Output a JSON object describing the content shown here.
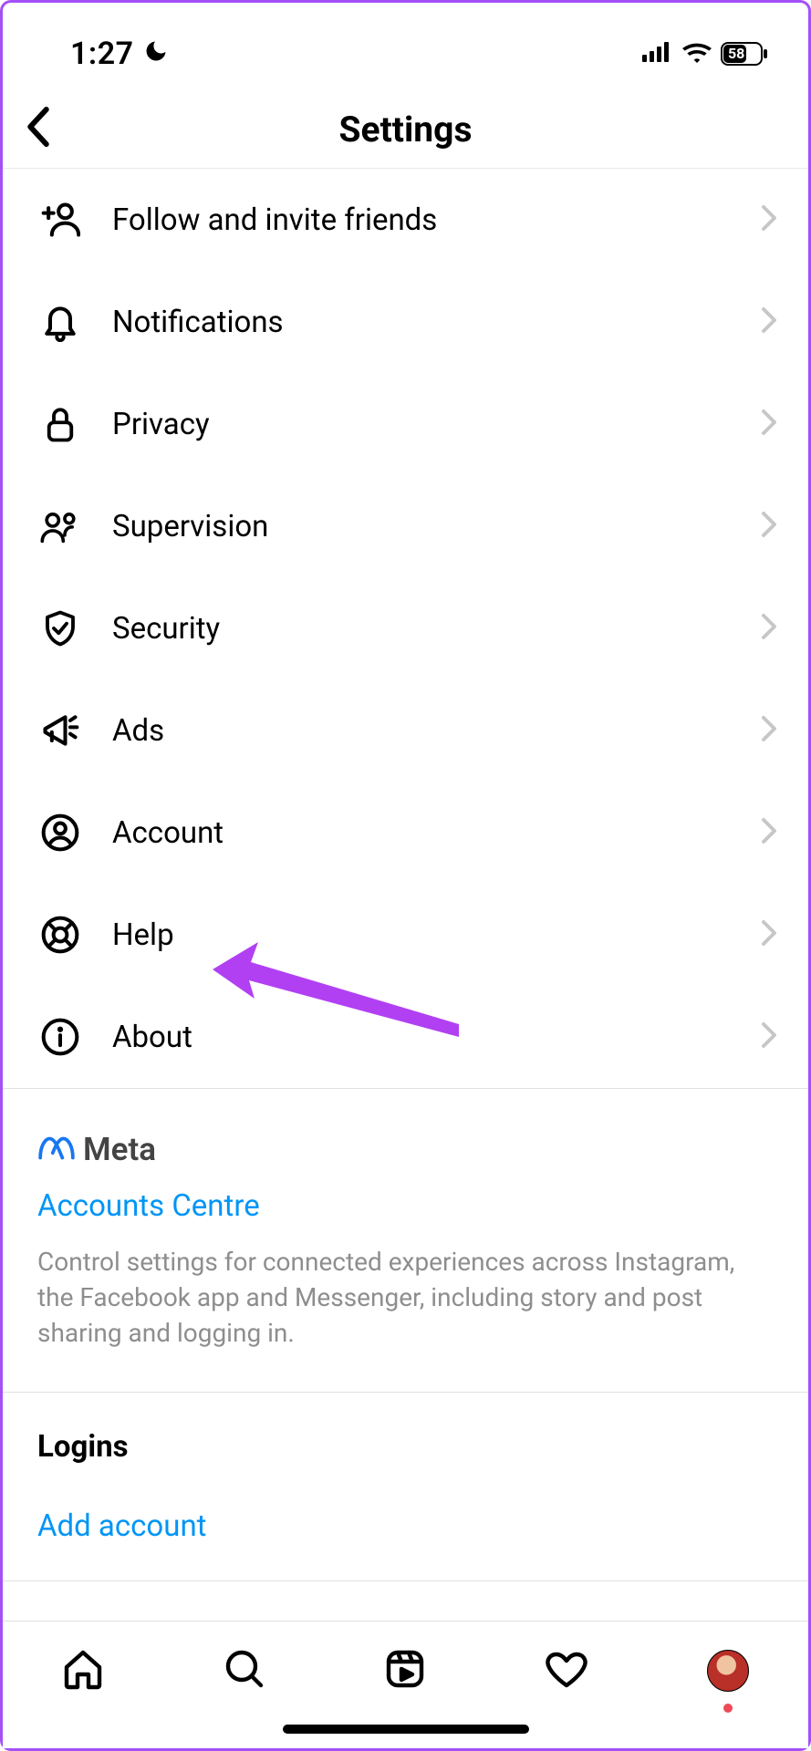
{
  "status": {
    "time": "1:27",
    "battery": "58"
  },
  "header": {
    "title": "Settings"
  },
  "menu": [
    {
      "icon": "user-plus",
      "label": "Follow and invite friends"
    },
    {
      "icon": "bell",
      "label": "Notifications"
    },
    {
      "icon": "lock",
      "label": "Privacy"
    },
    {
      "icon": "people",
      "label": "Supervision"
    },
    {
      "icon": "shield",
      "label": "Security"
    },
    {
      "icon": "megaphone",
      "label": "Ads"
    },
    {
      "icon": "account",
      "label": "Account"
    },
    {
      "icon": "lifebuoy",
      "label": "Help"
    },
    {
      "icon": "info",
      "label": "About"
    }
  ],
  "meta": {
    "brand": "Meta",
    "link": "Accounts Centre",
    "desc": "Control settings for connected experiences across Instagram, the Facebook app and Messenger, including story and post sharing and logging in."
  },
  "logins": {
    "title": "Logins",
    "add": "Add account"
  }
}
